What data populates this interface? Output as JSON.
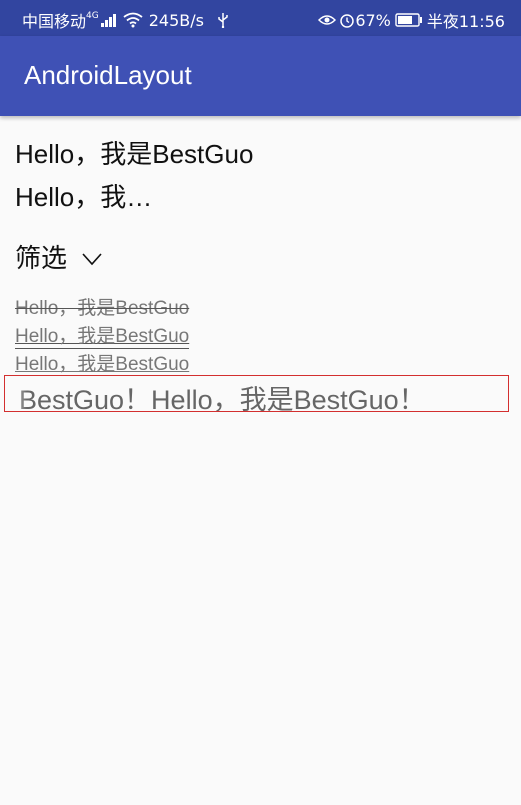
{
  "status_bar": {
    "carrier": "中国移动",
    "network_type": "4G",
    "speed": "245B/s",
    "battery": "67%",
    "time": "半夜11:56",
    "icons": [
      "signal-icon",
      "wifi-icon",
      "usb-icon",
      "eye-icon",
      "alarm-icon",
      "battery-icon"
    ]
  },
  "app_bar": {
    "title": "AndroidLayout",
    "color": "#3f51b5",
    "status_color": "#3245a0"
  },
  "content": {
    "line1": "Hello，我是BestGuo",
    "line2": "Hello，我…",
    "filter_label": "筛选",
    "strike_text": "Hello，我是BestGuo",
    "underline_text": "Hello，我是BestGuo",
    "underline_text_2": "Hello，我是BestGuo",
    "marquee_text": "BestGuo！Hello，我是BestGuo！",
    "marquee_border_color": "#d32f2f"
  }
}
